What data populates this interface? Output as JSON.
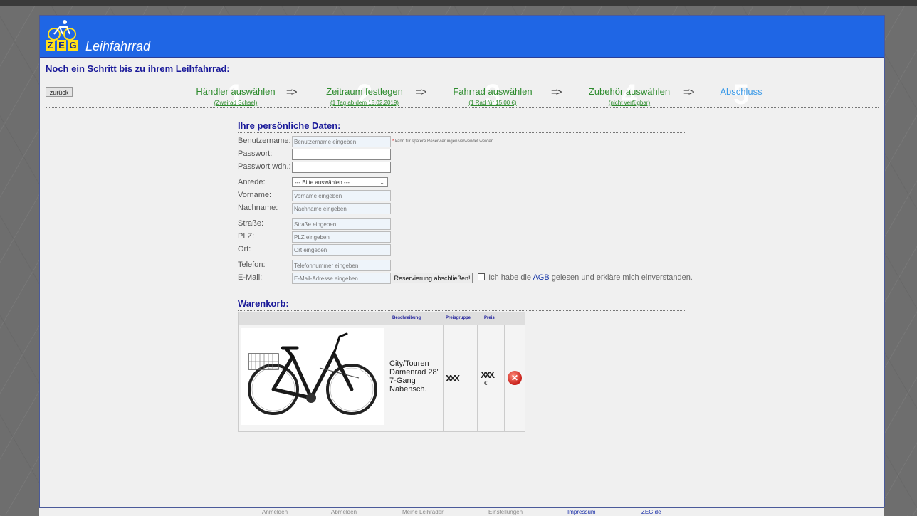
{
  "app": {
    "logo_letters": [
      "Z",
      "E",
      "G"
    ],
    "title": "Leihfahrrad"
  },
  "heading": "Noch ein Schritt bis zu ihrem Leihfahrrad:",
  "back_button": "zurück",
  "steps": [
    {
      "number": "1",
      "label": "Händler auswählen",
      "sub": "(Zweirad Schael)"
    },
    {
      "number": "2",
      "label": "Zeitraum festlegen",
      "sub": "(1 Tag ab dem 15.02.2019)"
    },
    {
      "number": "3",
      "label": "Fahrrad auswählen",
      "sub": "(1 Rad für 15,00 €)"
    },
    {
      "number": "4",
      "label": "Zubehör auswählen",
      "sub": "(nicht verfügbar)"
    },
    {
      "number": "5",
      "label": "Abschluss",
      "sub": ""
    }
  ],
  "arrow": "=>",
  "personal": {
    "title": "Ihre persönliche Daten:",
    "hint": "kann für spätere Reservierungen verwendet werden.",
    "hint_star": "*",
    "fields": {
      "username": {
        "label": "Benutzername:",
        "placeholder": "Benutzername eingeben"
      },
      "password": {
        "label": "Passwort:",
        "placeholder": ""
      },
      "password_repeat": {
        "label": "Passwort wdh.:",
        "placeholder": ""
      },
      "salutation": {
        "label": "Anrede:",
        "value": "--- Bitte auswählen ---"
      },
      "firstname": {
        "label": "Vorname:",
        "placeholder": "Vorname eingeben"
      },
      "lastname": {
        "label": "Nachname:",
        "placeholder": "Nachname eingeben"
      },
      "street": {
        "label": "Straße:",
        "placeholder": "Straße eingeben"
      },
      "zip": {
        "label": "PLZ:",
        "placeholder": "PLZ eingeben"
      },
      "city": {
        "label": "Ort:",
        "placeholder": "Ort eingeben"
      },
      "phone": {
        "label": "Telefon:",
        "placeholder": "Telefonnummer eingeben"
      },
      "email": {
        "label": "E-Mail:",
        "placeholder": "E-Mail-Adresse eingeben"
      }
    },
    "submit": "Reservierung abschließen!",
    "agb_before": "Ich habe die",
    "agb_link": "AGB",
    "agb_after": "gelesen und erkläre mich einverstanden."
  },
  "cart": {
    "title": "Warenkorb:",
    "headers": [
      "Beschreibung",
      "Preisgruppe",
      "Preis"
    ],
    "item": {
      "description": "City/Touren Damenrad 28\" 7-Gang Nabensch.",
      "price_group": "XXX",
      "price": "XXX",
      "currency": "€"
    }
  },
  "footer": [
    "Anmelden",
    "Abmelden",
    "Meine Leihräder",
    "Einstellungen",
    "Impressum",
    "ZEG.de"
  ],
  "colors": {
    "header_blue": "#1f66e5",
    "heading_blue": "#1a1a9a",
    "step_green": "#2e8b2e",
    "step_active": "#3a9ae8"
  }
}
